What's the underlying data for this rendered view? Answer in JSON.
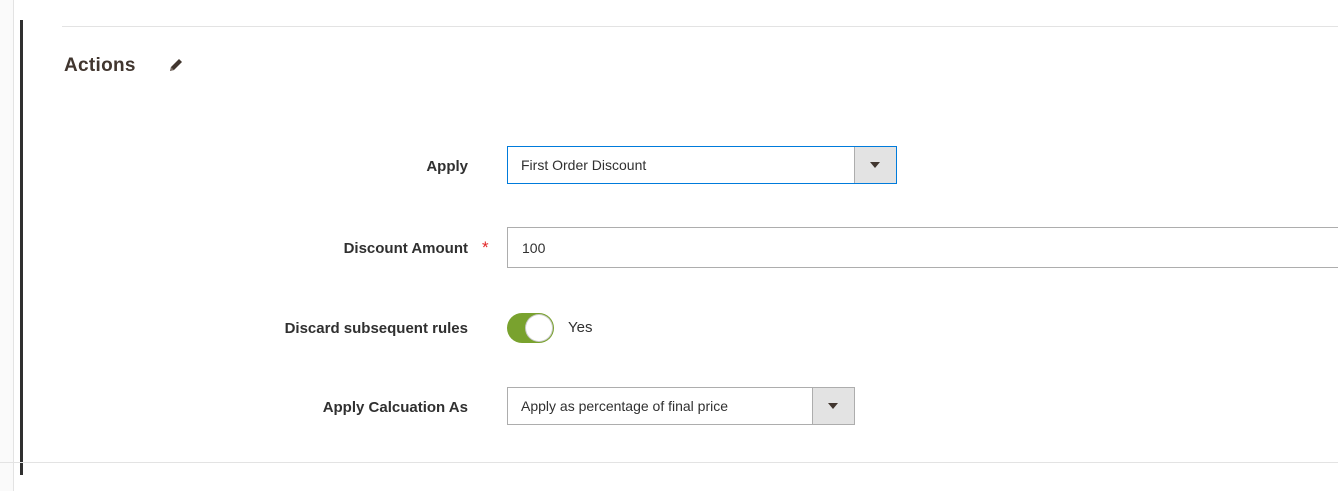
{
  "section": {
    "title": "Actions",
    "edit_icon": "pencil-icon"
  },
  "fields": {
    "apply": {
      "label": "Apply",
      "value": "First Order Discount"
    },
    "discount_amount": {
      "label": "Discount Amount",
      "required_mark": "*",
      "value": "100"
    },
    "discard_rules": {
      "label": "Discard subsequent rules",
      "state_label": "Yes",
      "enabled": true
    },
    "calc_as": {
      "label": "Apply Calcuation As",
      "value": "Apply as percentage of final price"
    }
  },
  "colors": {
    "toggle_on": "#79a22e",
    "required": "#e22626",
    "focus_border": "#007bdb"
  }
}
